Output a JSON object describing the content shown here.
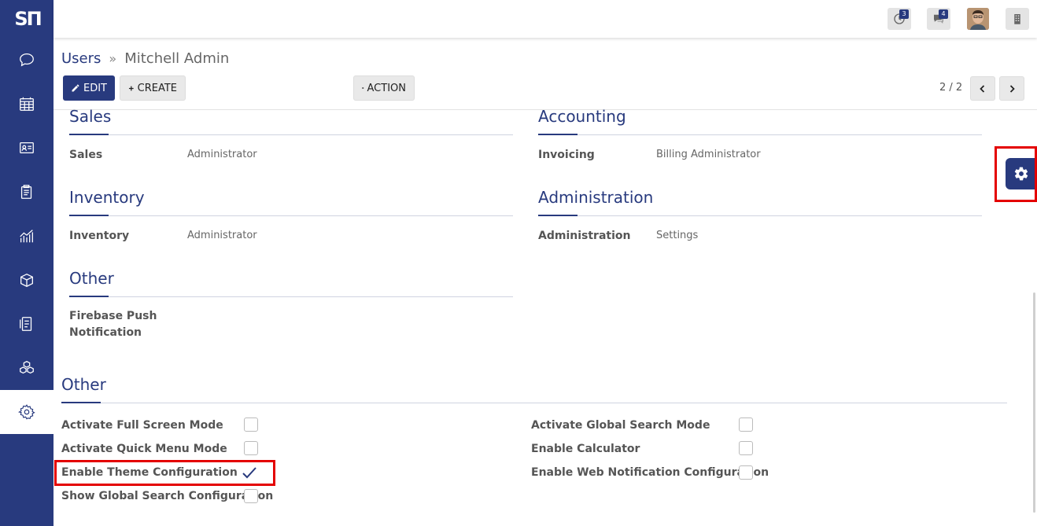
{
  "app": {
    "logo_text": "ЅП"
  },
  "sidebar": {
    "items": [
      {
        "icon": "chat-icon"
      },
      {
        "icon": "calendar-icon"
      },
      {
        "icon": "contact-card-icon"
      },
      {
        "icon": "clipboard-icon"
      },
      {
        "icon": "chart-icon"
      },
      {
        "icon": "box-icon"
      },
      {
        "icon": "receipt-icon"
      },
      {
        "icon": "cubes-icon"
      },
      {
        "icon": "settings-icon",
        "active": true
      }
    ]
  },
  "topbar": {
    "activity_count": "3",
    "messages_count": "4"
  },
  "breadcrumb": {
    "parent": "Users",
    "separator": "»",
    "current": "Mitchell Admin"
  },
  "toolbar": {
    "edit_label": "EDIT",
    "create_label": "CREATE",
    "action_label": "ACTION"
  },
  "pager": {
    "text": "2 / 2"
  },
  "groups": {
    "sales": {
      "title": "Sales",
      "label": "Sales",
      "value": "Administrator"
    },
    "accounting": {
      "title": "Accounting",
      "label": "Invoicing",
      "value": "Billing Administrator"
    },
    "inventory": {
      "title": "Inventory",
      "label": "Inventory",
      "value": "Administrator"
    },
    "administration": {
      "title": "Administration",
      "label": "Administration",
      "value": "Settings"
    },
    "other": {
      "title": "Other",
      "label_line1": "Firebase Push",
      "label_line2": "Notification"
    }
  },
  "other_section": {
    "title": "Other",
    "left": [
      {
        "label": "Activate Full Screen Mode",
        "checked": false
      },
      {
        "label": "Activate Quick Menu Mode",
        "checked": false
      },
      {
        "label": "Enable Theme Configuration",
        "checked": true
      },
      {
        "label": "Show Global Search Configuration",
        "checked": false
      }
    ],
    "right": [
      {
        "label": "Activate Global Search Mode",
        "checked": false
      },
      {
        "label": "Enable Calculator",
        "checked": false
      },
      {
        "label": "Enable Web Notification Configuration",
        "checked": false
      }
    ]
  },
  "colors": {
    "primary": "#283a7e",
    "highlight": "#e40000"
  }
}
